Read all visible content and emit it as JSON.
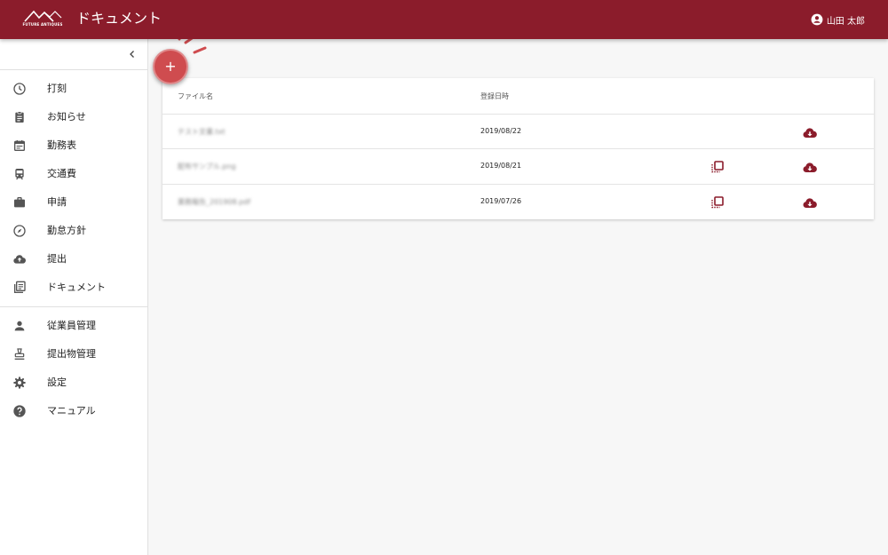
{
  "header": {
    "logo_text": "FUTURE ANTIQUES",
    "title": "ドキュメント",
    "user_name": "山田 太郎"
  },
  "sidebar": {
    "items": [
      {
        "label": "打刻",
        "icon": "clock-icon"
      },
      {
        "label": "お知らせ",
        "icon": "clipboard-icon"
      },
      {
        "label": "勤務表",
        "icon": "calendar-icon"
      },
      {
        "label": "交通費",
        "icon": "train-icon"
      },
      {
        "label": "申請",
        "icon": "briefcase-icon"
      },
      {
        "label": "勤怠方針",
        "icon": "compass-icon"
      },
      {
        "label": "提出",
        "icon": "cloud-upload-icon"
      },
      {
        "label": "ドキュメント",
        "icon": "library-books-icon"
      }
    ],
    "admin_items": [
      {
        "label": "従業員管理",
        "icon": "person-icon"
      },
      {
        "label": "提出物管理",
        "icon": "stamp-icon"
      },
      {
        "label": "設定",
        "icon": "gear-icon"
      },
      {
        "label": "マニュアル",
        "icon": "help-icon"
      }
    ]
  },
  "fab": {
    "label": "+"
  },
  "table": {
    "columns": [
      "ファイル名",
      "登録日時"
    ],
    "rows": [
      {
        "name": "テスト文書.txt",
        "date": "2019/08/22",
        "has_copy": false
      },
      {
        "name": "配布サンプル.png",
        "date": "2019/08/21",
        "has_copy": true
      },
      {
        "name": "業務報告_201908.pdf",
        "date": "2019/07/26",
        "has_copy": true
      }
    ]
  },
  "colors": {
    "brand": "#8b1c2b",
    "fab": "#cf4c4f",
    "icon_accent": "#8b1c2b"
  }
}
